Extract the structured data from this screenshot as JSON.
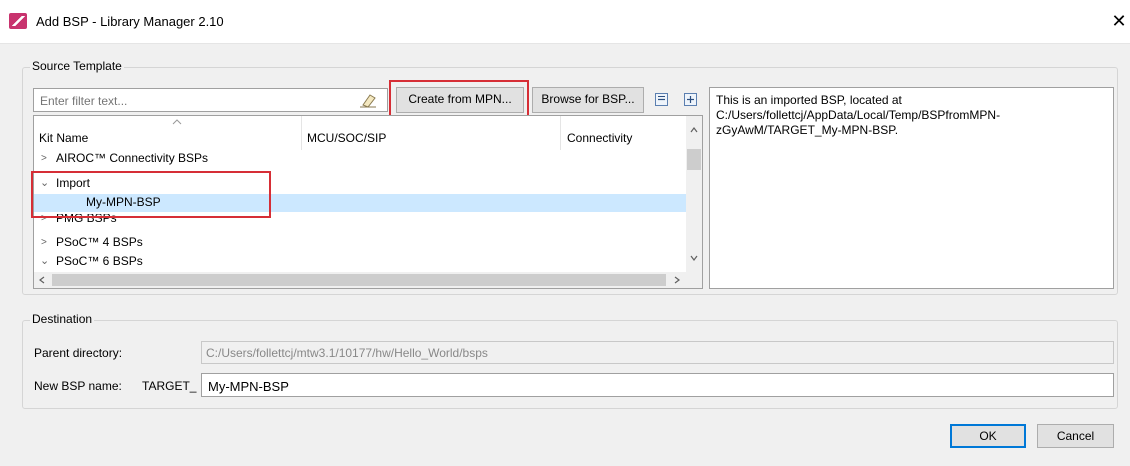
{
  "window": {
    "title": "Add BSP - Library Manager 2.10",
    "close_glyph": "✕"
  },
  "source_template": {
    "legend": "Source Template",
    "filter_placeholder": "Enter filter text...",
    "create_from_mpn": "Create from MPN...",
    "browse_for_bsp": "Browse for BSP...",
    "columns": [
      "Kit Name",
      "MCU/SOC/SIP",
      "Connectivity"
    ],
    "rows": [
      {
        "label": "AIROC™ Connectivity BSPs",
        "expanded": false
      },
      {
        "label": "Import",
        "expanded": true
      },
      {
        "label": "My-MPN-BSP",
        "child": true,
        "selected": true
      },
      {
        "label": "PMG BSPs",
        "expanded": false
      },
      {
        "label": "PSoC™ 4 BSPs",
        "expanded": false
      },
      {
        "label": "PSoC™ 6 BSPs",
        "expanded": true
      }
    ],
    "description": "This is an imported BSP, located at C:/Users/follettcj/AppData/Local/Temp/BSPfromMPN-zGyAwM/TARGET_My-MPN-BSP."
  },
  "destination": {
    "legend": "Destination",
    "parent_label": "Parent directory:",
    "parent_value": "C:/Users/follettcj/mtw3.1/10177/hw/Hello_World/bsps",
    "name_label": "New BSP name:",
    "name_prefix": "TARGET_",
    "name_value": "My-MPN-BSP"
  },
  "buttons": {
    "ok": "OK",
    "cancel": "Cancel"
  },
  "colors": {
    "highlight": "#d62e36",
    "selection": "#cce8ff",
    "accent": "#0078d7"
  }
}
